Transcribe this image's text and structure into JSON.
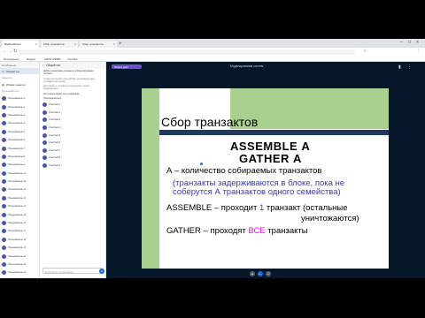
{
  "browser": {
    "tabs": [
      {
        "label": "BigBlueButton"
      },
      {
        "label": "Сбор транзактов"
      },
      {
        "label": "Сбор транзактов"
      }
    ],
    "url": "",
    "bookmarks": [
      "Приложения",
      "Яндекс",
      "НИЯУ МИФИ",
      "YouTube"
    ]
  },
  "sidebar": {
    "messages_header": "Сообщения",
    "public_chat": "Общий чат",
    "notes_header": "Заметки",
    "shared_notes": "Общие заметки",
    "users_header": "Пользователи",
    "users": [
      "Пользователь 1",
      "Пользователь 2",
      "Пользователь 3",
      "Пользователь 4",
      "Пользователь 5",
      "Пользователь 6",
      "Пользователь 7",
      "Пользователь 8",
      "Пользователь 9",
      "Пользователь 10",
      "Пользователь 11",
      "Пользователь 12",
      "Пользователь 13",
      "Пользователь 14",
      "Пользователь 15",
      "Пользователь 16",
      "Пользователь 17",
      "Пользователь 18",
      "Пользователь 19",
      "Пользователь 20",
      "Пользователь 21",
      "Пользователь 22"
    ]
  },
  "chat": {
    "header": "Общий чат",
    "welcome_lines": [
      "Добро пожаловать в комнату «Моделирование систем»!",
      "Чтобы пригласить кого-нибудь на конференцию, отправьте им ссылку.",
      "Для связи по телефону используйте номер конференции."
    ],
    "notes_lines": [
      "Эта сессия может быть записана.",
      "Присоединиться"
    ],
    "messages": [
      "Участник 1",
      "Участник 2",
      "Участник 3",
      "Участник 4",
      "Участник 5",
      "Участник 6",
      "Участник 7",
      "Участник 8",
      "Участник 9"
    ],
    "input_placeholder": "Отправить сообщение"
  },
  "presentation": {
    "title": "Моделирование систем",
    "recording_badge": "Запись идёт",
    "slide": {
      "title": "Сбор транзактов",
      "cmd_assemble": "ASSEMBLE  А",
      "cmd_gather": "GATHER  А",
      "line1": "А – количество собираемых транзактов",
      "line2": "(транзакты задерживаются в блоке, пока не",
      "line3": "соберутся А транзактов одного семейства)",
      "line4_pre": "ASSEMBLE – проходит ",
      "line4_num": "1",
      "line4_post": " транзакт (остальные",
      "line5": "уничтожаются)",
      "line6_pre": "GATHER – проходят ",
      "line6_all": "ВСЕ",
      "line6_post": " транзакты"
    }
  },
  "colors": {
    "slide_green": "#a9d08e",
    "slide_bar": "#1f3a5c",
    "blue_text": "#3333cc",
    "magenta_text": "#ff00ff",
    "bbb_blue": "#0f70d7",
    "presentation_bg": "#06172a"
  }
}
